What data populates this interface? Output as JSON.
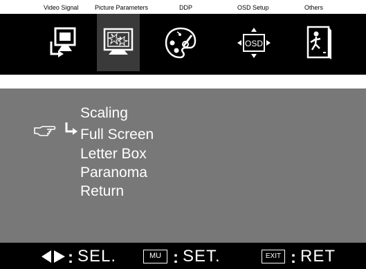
{
  "tabs": [
    {
      "label": "Video Signal",
      "icon": "monitor-input-icon"
    },
    {
      "label": "Picture Parameters",
      "icon": "picture-parameters-icon"
    },
    {
      "label": "DDP",
      "icon": "palette-icon"
    },
    {
      "label": "OSD Setup",
      "icon": "osd-setup-icon"
    },
    {
      "label": "Others",
      "icon": "exit-door-icon"
    }
  ],
  "selected_tab": "Picture Parameters",
  "menu": {
    "title": "Scaling",
    "items": [
      "Full Screen",
      "Letter Box",
      "Paranoma",
      "Return"
    ],
    "selected_item": "Full Screen"
  },
  "footer": {
    "sel_label": "SEL.",
    "mu_key": "MU",
    "set_label": "SET.",
    "exit_key": "EXIT",
    "ret_label": "RET"
  },
  "colors": {
    "bar": "#000000",
    "panel": "#787878",
    "selected_tab": "#3a3a3a",
    "text": "#ffffff"
  }
}
